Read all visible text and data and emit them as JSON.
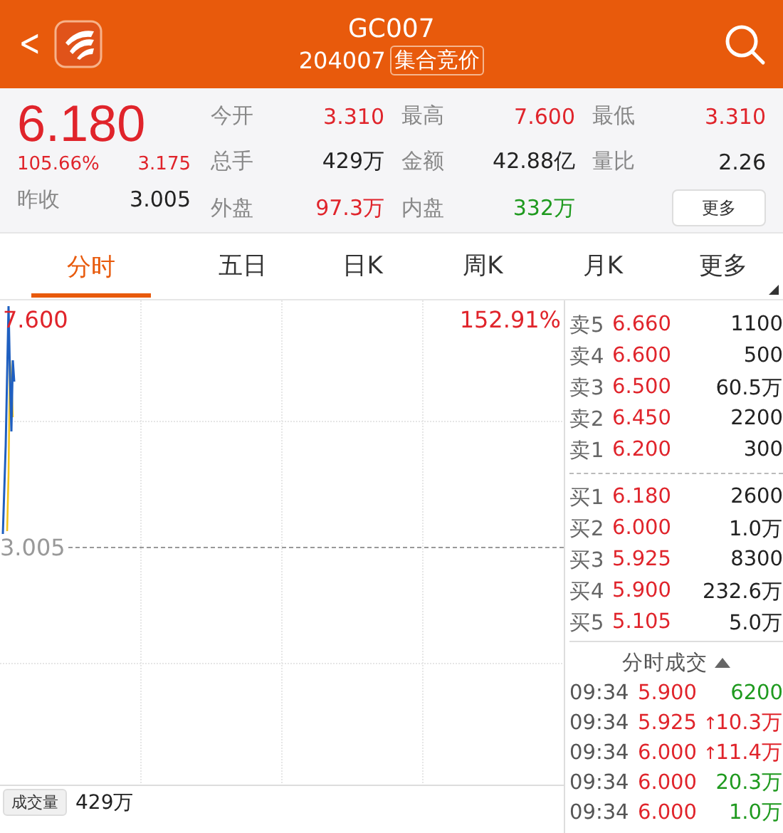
{
  "header": {
    "back": "<",
    "title": "GC007",
    "code": "204007",
    "tag": "集合竞价"
  },
  "quote": {
    "price": "6.180",
    "change_pct": "105.66%",
    "change": "3.175",
    "prev_close_label": "昨收",
    "prev_close": "3.005",
    "stats": [
      {
        "label": "今开",
        "value": "3.310",
        "color": "#e0242b"
      },
      {
        "label": "最高",
        "value": "7.600",
        "color": "#e0242b"
      },
      {
        "label": "最低",
        "value": "3.310",
        "color": "#e0242b"
      },
      {
        "label": "总手",
        "value": "429万",
        "color": "#222222"
      },
      {
        "label": "金额",
        "value": "42.88亿",
        "color": "#222222"
      },
      {
        "label": "量比",
        "value": "2.26",
        "color": "#222222"
      },
      {
        "label": "外盘",
        "value": "97.3万",
        "color": "#e0242b"
      },
      {
        "label": "内盘",
        "value": "332万",
        "color": "#1f9a1f"
      }
    ],
    "more_button": "更多"
  },
  "tabs": [
    {
      "label": "分时",
      "selected": true
    },
    {
      "label": "五日",
      "selected": false
    },
    {
      "label": "日K",
      "selected": false
    },
    {
      "label": "周K",
      "selected": false
    },
    {
      "label": "月K",
      "selected": false
    },
    {
      "label": "更多",
      "selected": false
    }
  ],
  "chart": {
    "high_label": "7.600",
    "high_pct": "152.91%",
    "base_label": "3.005",
    "volume_button": "成交量",
    "volume": "429万"
  },
  "order_book": {
    "asks": [
      {
        "label": "卖5",
        "price": "6.660",
        "volume": "1100"
      },
      {
        "label": "卖4",
        "price": "6.600",
        "volume": "500"
      },
      {
        "label": "卖3",
        "price": "6.500",
        "volume": "60.5万"
      },
      {
        "label": "卖2",
        "price": "6.450",
        "volume": "2200"
      },
      {
        "label": "卖1",
        "price": "6.200",
        "volume": "300"
      }
    ],
    "bids": [
      {
        "label": "买1",
        "price": "6.180",
        "volume": "2600"
      },
      {
        "label": "买2",
        "price": "6.000",
        "volume": "1.0万"
      },
      {
        "label": "买3",
        "price": "5.925",
        "volume": "8300"
      },
      {
        "label": "买4",
        "price": "5.900",
        "volume": "232.6万"
      },
      {
        "label": "买5",
        "price": "5.105",
        "volume": "5.0万"
      }
    ]
  },
  "trades": {
    "title": "分时成交",
    "rows": [
      {
        "time": "09:34",
        "price": "5.900",
        "volume": "6200",
        "color": "#1f9a1f"
      },
      {
        "time": "09:34",
        "price": "5.925",
        "arrow": "↑",
        "volume": "10.3万",
        "color": "#e0242b"
      },
      {
        "time": "09:34",
        "price": "6.000",
        "arrow": "↑",
        "volume": "11.4万",
        "color": "#e0242b"
      },
      {
        "time": "09:34",
        "price": "6.000",
        "volume": "20.3万",
        "color": "#1f9a1f"
      },
      {
        "time": "09:34",
        "price": "6.000",
        "volume": "1.0万",
        "color": "#1f9a1f"
      }
    ]
  }
}
